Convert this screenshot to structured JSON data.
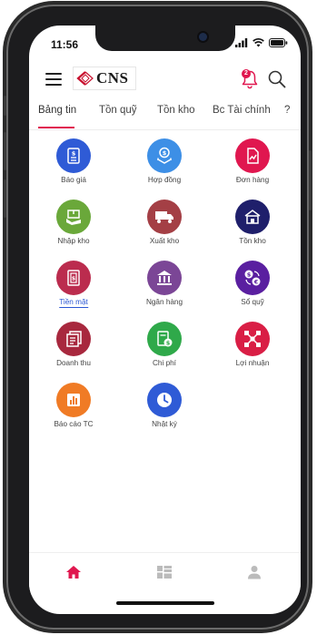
{
  "status_bar": {
    "time": "11:56"
  },
  "header": {
    "logo_text": "CNS",
    "notification_count": "2"
  },
  "tabs": [
    {
      "label": "Bảng tin",
      "active": true
    },
    {
      "label": "Tồn quỹ",
      "active": false
    },
    {
      "label": "Tồn kho",
      "active": false
    },
    {
      "label": "Bc Tài chính",
      "active": false
    },
    {
      "label": "?",
      "active": false
    }
  ],
  "tiles": [
    {
      "label": "Báo giá",
      "icon": "quote-document-icon",
      "color": "#2f5bd6"
    },
    {
      "label": "Hợp đồng",
      "icon": "contract-money-icon",
      "color": "#3d8fe6"
    },
    {
      "label": "Đơn hàng",
      "icon": "order-chart-icon",
      "color": "#e0174f"
    },
    {
      "label": "Nhập kho",
      "icon": "import-box-icon",
      "color": "#6aa83a"
    },
    {
      "label": "Xuất kho",
      "icon": "delivery-truck-icon",
      "color": "#a43f45"
    },
    {
      "label": "Tồn kho",
      "icon": "warehouse-icon",
      "color": "#1f1f6b"
    },
    {
      "label": "Tiền mặt",
      "icon": "cash-icon",
      "color": "#bb2c4e",
      "selected": true
    },
    {
      "label": "Ngân hàng",
      "icon": "bank-icon",
      "color": "#7b4696"
    },
    {
      "label": "Sổ quỹ",
      "icon": "currency-exchange-icon",
      "color": "#5a1fa0"
    },
    {
      "label": "Doanh thu",
      "icon": "revenue-report-icon",
      "color": "#a8283e"
    },
    {
      "label": "Chi phí",
      "icon": "expense-calculator-icon",
      "color": "#2fa94a"
    },
    {
      "label": "Lợi nhuận",
      "icon": "profit-network-icon",
      "color": "#d91e45"
    },
    {
      "label": "Báo cáo TC",
      "icon": "financial-report-icon",
      "color": "#f07b25"
    },
    {
      "label": "Nhật ký",
      "icon": "clock-icon",
      "color": "#2f5bd6"
    }
  ],
  "bottom_nav": [
    {
      "icon": "home-icon",
      "active": true,
      "color": "#e0174f"
    },
    {
      "icon": "dashboard-icon",
      "active": false,
      "color": "#bbbbbb"
    },
    {
      "icon": "user-icon",
      "active": false,
      "color": "#bbbbbb"
    }
  ]
}
